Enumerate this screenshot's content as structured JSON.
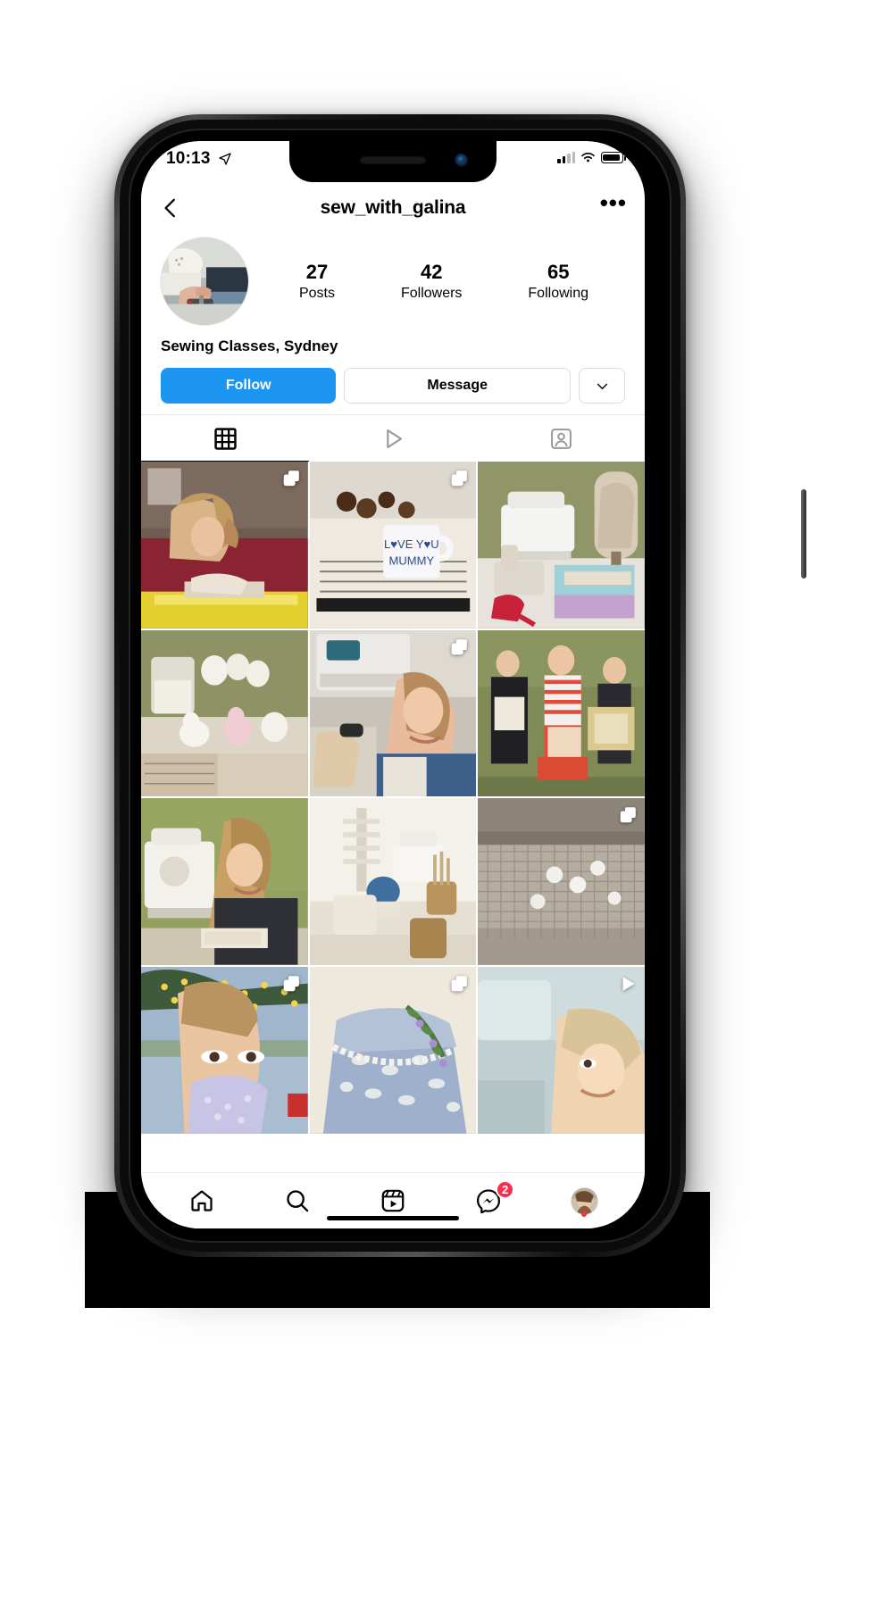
{
  "status_bar": {
    "time": "10:13",
    "location_icon": "location-arrow-icon",
    "signal_icon": "cellular-signal-icon",
    "wifi_icon": "wifi-icon",
    "battery_icon": "battery-full-icon"
  },
  "topbar": {
    "back_icon": "back-chevron-icon",
    "username": "sew_with_galina",
    "more_icon": "more-options-icon",
    "more_label": "•••"
  },
  "profile": {
    "avatar_alt": "profile-photo-sewing-machine",
    "bio": "Sewing Classes, Sydney",
    "stats": [
      {
        "num": "27",
        "label": "Posts"
      },
      {
        "num": "42",
        "label": "Followers"
      },
      {
        "num": "65",
        "label": "Following"
      }
    ],
    "actions": {
      "follow_label": "Follow",
      "follow_color": "#1b95f0",
      "message_label": "Message",
      "more_icon": "chevron-down-icon"
    }
  },
  "tabs": [
    {
      "name": "grid",
      "icon": "grid-icon",
      "active": true
    },
    {
      "name": "reels",
      "icon": "play-triangle-icon",
      "active": false
    },
    {
      "name": "tagged",
      "icon": "tagged-person-icon",
      "active": false
    }
  ],
  "grid": {
    "posts": [
      {
        "alt": "girl-sewing-yellow-fabric",
        "badge": "carousel"
      },
      {
        "alt": "love-you-mummy-mug-with-pouch",
        "badge": "carousel"
      },
      {
        "alt": "sewing-machine-and-mannequin",
        "badge": "none"
      },
      {
        "alt": "bunny-figurines-and-candle",
        "badge": "none"
      },
      {
        "alt": "girl-at-sewing-machine-smiling",
        "badge": "carousel"
      },
      {
        "alt": "three-girls-holding-quilt-bags",
        "badge": "none"
      },
      {
        "alt": "girl-threading-sewing-machine",
        "badge": "none"
      },
      {
        "alt": "sewing-studio-table-setup",
        "badge": "none"
      },
      {
        "alt": "linen-fabric-with-pins",
        "badge": "carousel"
      },
      {
        "alt": "girl-wearing-handmade-face-mask",
        "badge": "carousel"
      },
      {
        "alt": "blue-floral-skirt-with-lace",
        "badge": "carousel"
      },
      {
        "alt": "child-at-sewing-machine-video",
        "badge": "video"
      }
    ]
  },
  "navbar": {
    "items": [
      {
        "name": "home",
        "icon": "home-icon",
        "badge": ""
      },
      {
        "name": "search",
        "icon": "search-icon",
        "badge": ""
      },
      {
        "name": "reels",
        "icon": "reels-icon",
        "badge": ""
      },
      {
        "name": "messages",
        "icon": "messenger-icon",
        "badge": "2"
      },
      {
        "name": "profile",
        "icon": "profile-avatar-icon",
        "badge": ""
      }
    ],
    "message_badge_count": "2",
    "badge_color": "#fa2f4f"
  }
}
